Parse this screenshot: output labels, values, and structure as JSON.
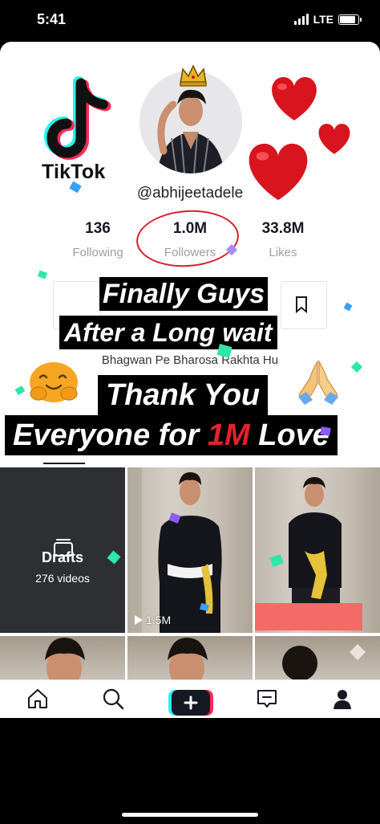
{
  "status_bar": {
    "time": "5:41",
    "network": "LTE",
    "battery_level": 0.85,
    "signal_bars": 4
  },
  "logo": {
    "text": "TikTok"
  },
  "profile": {
    "username": "@abhijeetadele",
    "bio": "Bhagwan Pe Bharosa Rakhta Hu"
  },
  "stats": [
    {
      "value": "136",
      "label": "Following"
    },
    {
      "value": "1.0M",
      "label": "Followers"
    },
    {
      "value": "33.8M",
      "label": "Likes"
    }
  ],
  "captions": {
    "line1": "Finally Guys",
    "line2": "After a Long wait",
    "line3": "Thank You",
    "line4_pre": "Everyone for ",
    "line4_highlight": "1M",
    "line4_post": " Love"
  },
  "drafts": {
    "title": "Drafts",
    "count": "276 videos"
  },
  "videos": [
    {
      "plays": "1.5M"
    }
  ],
  "nav": [
    "home-icon",
    "search-icon",
    "create-button",
    "inbox-icon",
    "profile-icon"
  ],
  "colors": {
    "accent_red": "#e3222c",
    "tiktok_cyan": "#25f4ee",
    "tiktok_pink": "#fe2c55",
    "drafts_bg": "#2e2f33"
  }
}
